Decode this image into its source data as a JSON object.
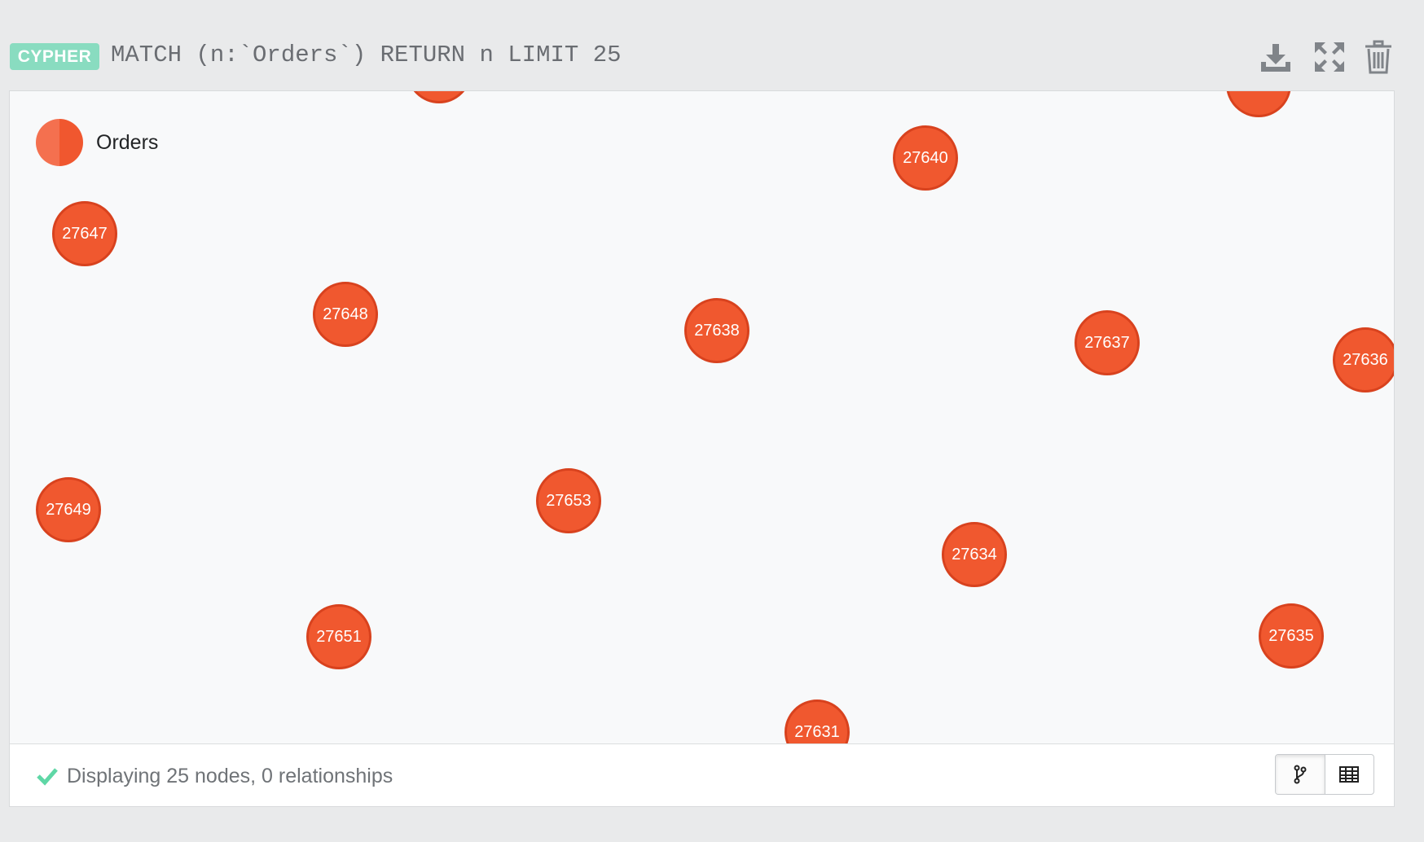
{
  "query": {
    "badge": "CYPHER",
    "text": "MATCH (n:`Orders`) RETURN n LIMIT 25"
  },
  "toolbar": {
    "icons": [
      "download-icon",
      "expand-icon",
      "trash-icon"
    ]
  },
  "legend": {
    "label": "Orders",
    "color": "#f0582f"
  },
  "nodes": [
    {
      "id": "27640",
      "label": "27640"
    },
    {
      "id": "27647",
      "label": "27647"
    },
    {
      "id": "27648",
      "label": "27648"
    },
    {
      "id": "27638",
      "label": "27638"
    },
    {
      "id": "27637",
      "label": "27637"
    },
    {
      "id": "27636",
      "label": "27636"
    },
    {
      "id": "27649",
      "label": "27649"
    },
    {
      "id": "27653",
      "label": "27653"
    },
    {
      "id": "27634",
      "label": "27634"
    },
    {
      "id": "27651",
      "label": "27651"
    },
    {
      "id": "27635",
      "label": "27635"
    },
    {
      "id": "27631",
      "label": "27631"
    },
    {
      "id": "partial-top-left",
      "label": ""
    },
    {
      "id": "partial-top-right",
      "label": ""
    }
  ],
  "status": {
    "text": "Displaying 25 nodes, 0 relationships",
    "icon": "check-icon"
  },
  "view_toggle": {
    "options": [
      "graph-view",
      "table-view"
    ],
    "active": "graph-view"
  },
  "colors": {
    "node_fill": "#f0582f",
    "node_border": "#d8421e",
    "badge": "#89dcc0",
    "check": "#5fd7a6"
  }
}
